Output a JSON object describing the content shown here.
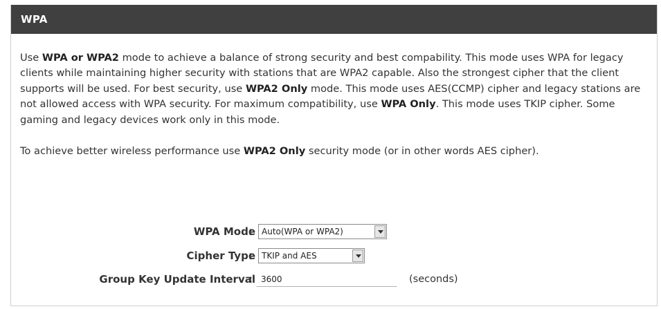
{
  "section": {
    "title": "WPA"
  },
  "description": {
    "p1": [
      {
        "t": "Use "
      },
      {
        "t": "WPA or WPA2",
        "b": true
      },
      {
        "t": " mode to achieve a balance of strong security and best compability. This mode uses WPA for legacy clients while maintaining higher security with stations that are WPA2 capable. Also the strongest cipher that the client supports will be used. For best security, use "
      },
      {
        "t": "WPA2 Only",
        "b": true
      },
      {
        "t": " mode. This mode uses AES(CCMP) cipher and legacy stations are not allowed access with WPA security. For maximum compatibility, use "
      },
      {
        "t": "WPA Only",
        "b": true
      },
      {
        "t": ". This mode uses TKIP cipher. Some gaming and legacy devices work only in this mode."
      }
    ],
    "p2": [
      {
        "t": "To achieve better wireless performance use "
      },
      {
        "t": "WPA2 Only",
        "b": true
      },
      {
        "t": " security mode (or in other words AES cipher)."
      }
    ]
  },
  "form": {
    "wpa_mode": {
      "label": "WPA Mode",
      "value": "Auto(WPA or WPA2)"
    },
    "cipher_type": {
      "label": "Cipher Type",
      "value": "TKIP and AES"
    },
    "group_key": {
      "label": "Group Key Update Interval",
      "value": "3600",
      "unit": "(seconds)"
    },
    "colon": ":"
  }
}
